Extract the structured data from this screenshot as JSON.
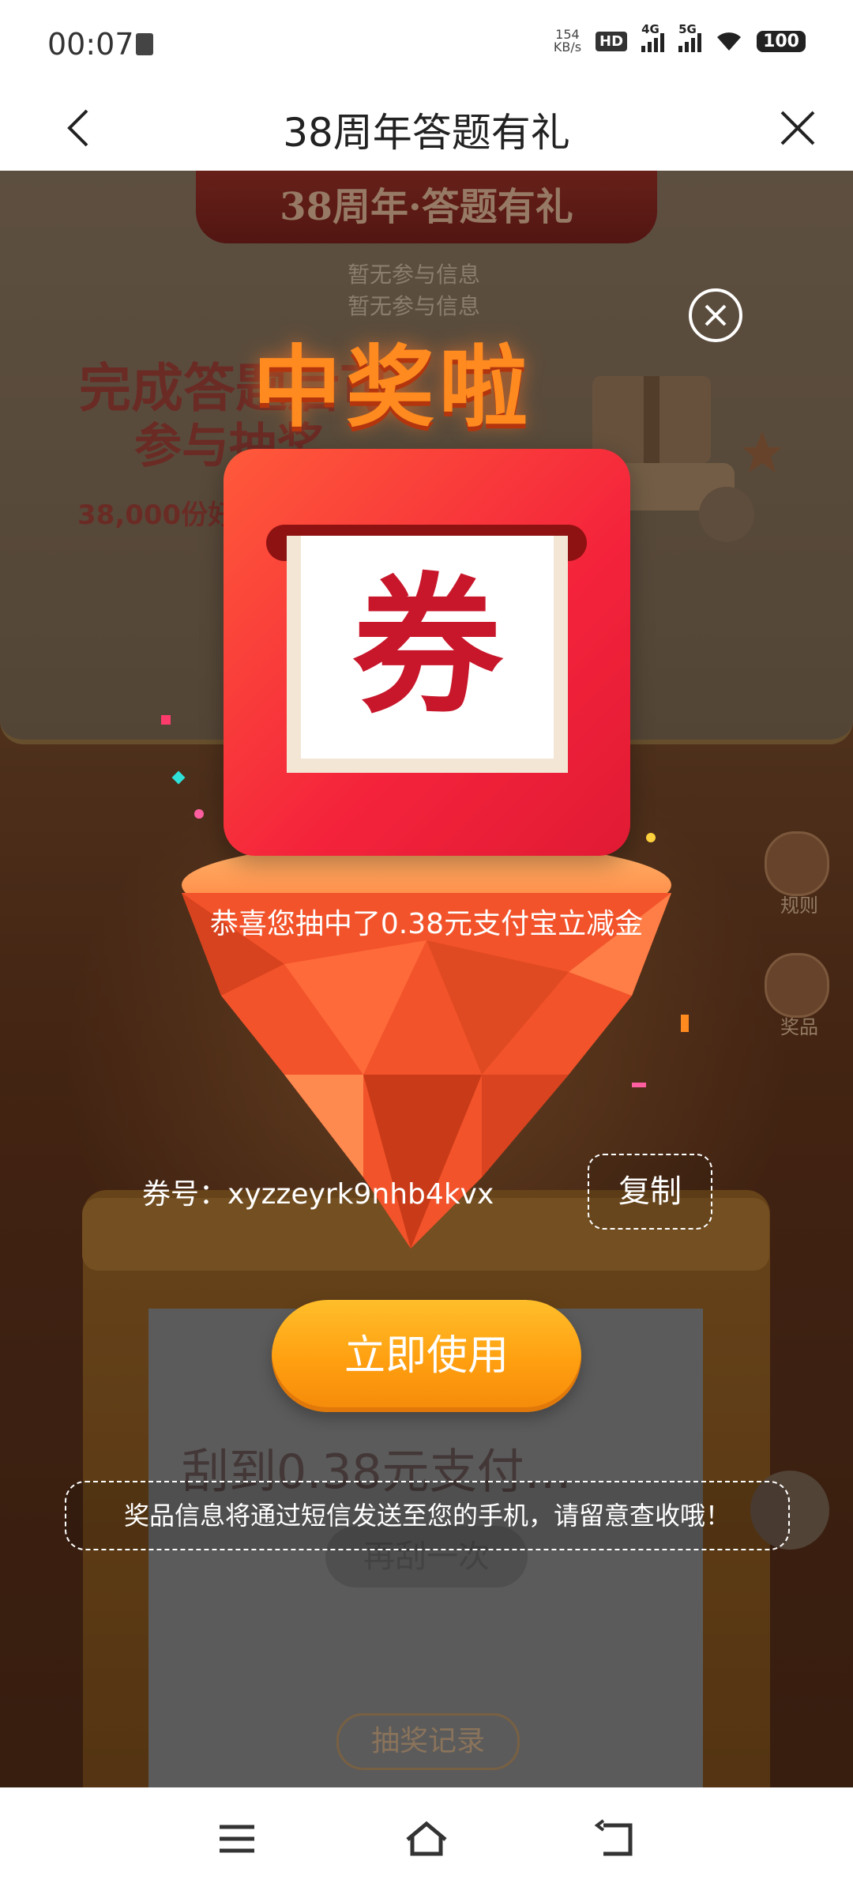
{
  "status_bar": {
    "time": "00:07",
    "speed_value": "154",
    "speed_unit": "KB/s",
    "hd": "HD",
    "net1": "4G",
    "net2": "5G",
    "battery": "100"
  },
  "nav": {
    "title": "38周年答题有礼"
  },
  "background": {
    "ribbon_title": "38周年·答题有礼",
    "ghost_line1": "暂无参与信息",
    "ghost_line2": "暂无参与信息",
    "headline1": "完成答题后可",
    "headline2": "参与抽奖",
    "subline": "38,000份好礼",
    "side_rules": "规则",
    "side_prizes": "奖品",
    "scratch_text": "刮到0.38元支付…",
    "retry": "再刮一次",
    "record": "抽奖记录"
  },
  "modal": {
    "win_title": "中奖啦",
    "coupon_char": "券",
    "congrats": "恭喜您抽中了0.38元支付宝立减金",
    "code_label": "券号：",
    "code_value": "xyzzeyrk9nhb4kvx",
    "copy": "复制",
    "use": "立即使用",
    "notice": "奖品信息将通过短信发送至您的手机，请留意查收哦！"
  },
  "colors": {
    "accent_orange": "#ff9f10",
    "coupon_red": "#e11a34",
    "title_orange": "#ff8a1f"
  }
}
